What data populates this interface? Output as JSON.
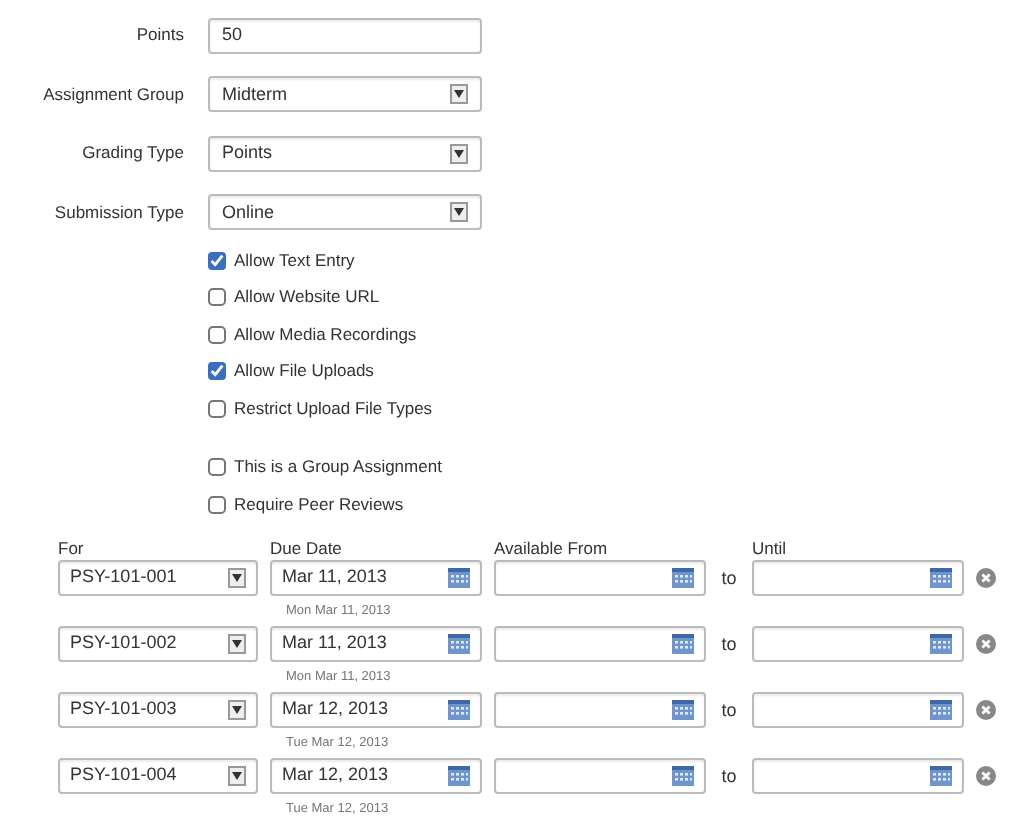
{
  "fields": [
    {
      "label": "Points",
      "kind": "text",
      "value": "50"
    },
    {
      "label": "Assignment Group",
      "kind": "select",
      "value": "Midterm"
    },
    {
      "label": "Grading Type",
      "kind": "select",
      "value": "Points"
    },
    {
      "label": "Submission Type",
      "kind": "select",
      "value": "Online"
    }
  ],
  "submission_options": [
    {
      "label": "Allow Text Entry",
      "checked": true
    },
    {
      "label": "Allow Website URL",
      "checked": false
    },
    {
      "label": "Allow Media Recordings",
      "checked": false
    },
    {
      "label": "Allow File Uploads",
      "checked": true
    },
    {
      "label": "Restrict Upload File Types",
      "checked": false
    }
  ],
  "group_options": [
    {
      "label": "This is a Group Assignment",
      "checked": false
    },
    {
      "label": "Require Peer Reviews",
      "checked": false
    }
  ],
  "columns": [
    "For",
    "Due Date",
    "Available From",
    "Until"
  ],
  "overrides": [
    {
      "section": "PSY-101-001",
      "due_date": "Mar 11, 2013",
      "due_hint": "Mon Mar 11, 2013",
      "separator": "to"
    },
    {
      "section": "PSY-101-002",
      "due_date": "Mar 11, 2013",
      "due_hint": "Mon Mar 11, 2013",
      "separator": "to"
    },
    {
      "section": "PSY-101-003",
      "due_date": "Mar 12, 2013",
      "due_hint": "Tue Mar 12, 2013",
      "separator": "to"
    },
    {
      "section": "PSY-101-004",
      "due_date": "Mar 12, 2013",
      "due_hint": "Tue Mar 12, 2013",
      "separator": "to"
    }
  ]
}
